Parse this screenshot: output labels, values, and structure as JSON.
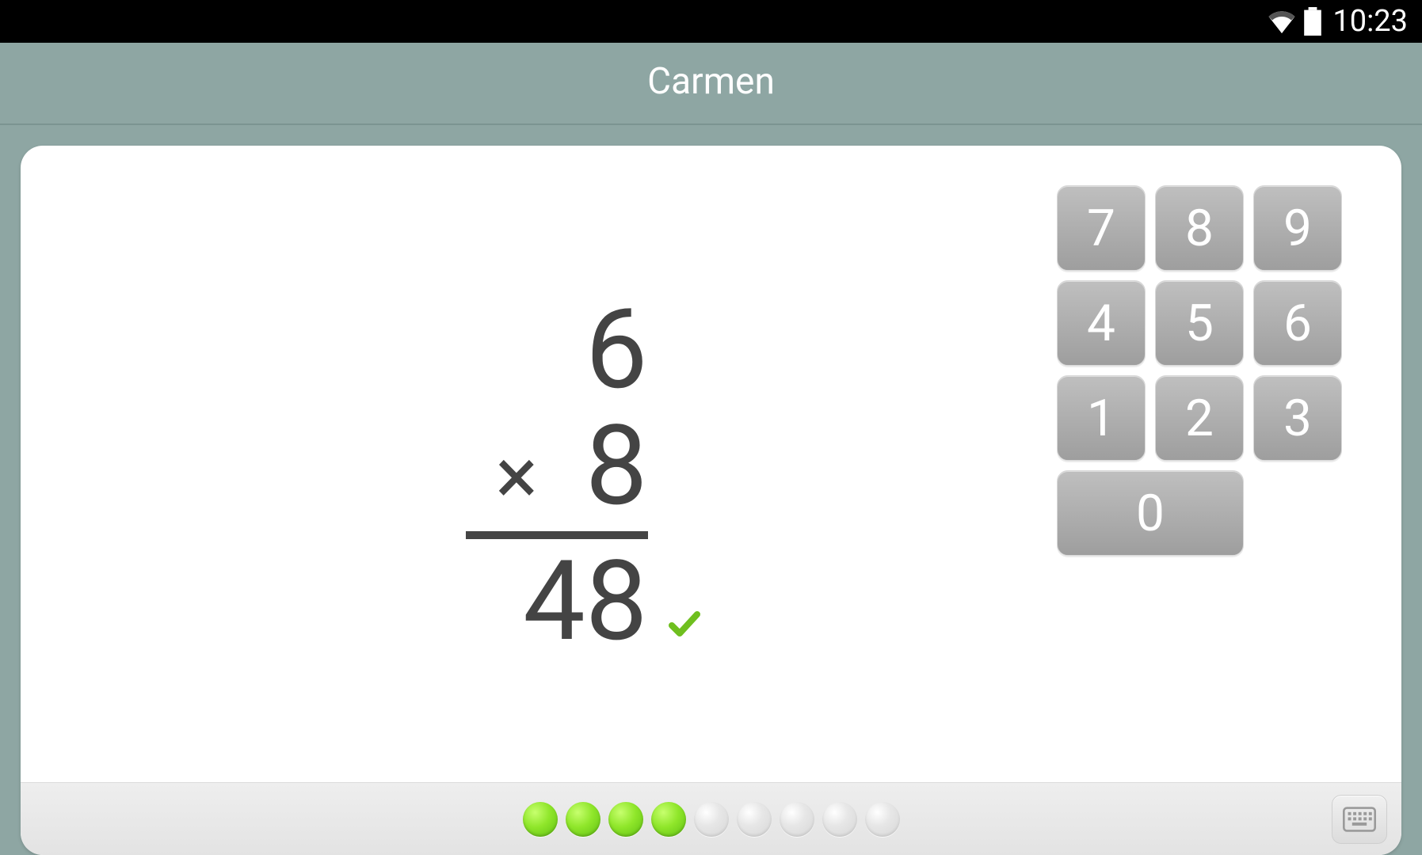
{
  "status": {
    "time": "10:23"
  },
  "header": {
    "title": "Carmen"
  },
  "problem": {
    "operand1": "6",
    "operator": "×",
    "operand2": "8",
    "answer": "48",
    "correct": true
  },
  "keypad": {
    "k7": "7",
    "k8": "8",
    "k9": "9",
    "k4": "4",
    "k5": "5",
    "k6": "6",
    "k1": "1",
    "k2": "2",
    "k3": "3",
    "k0": "0"
  },
  "progress": {
    "completed": 4,
    "total": 9
  }
}
